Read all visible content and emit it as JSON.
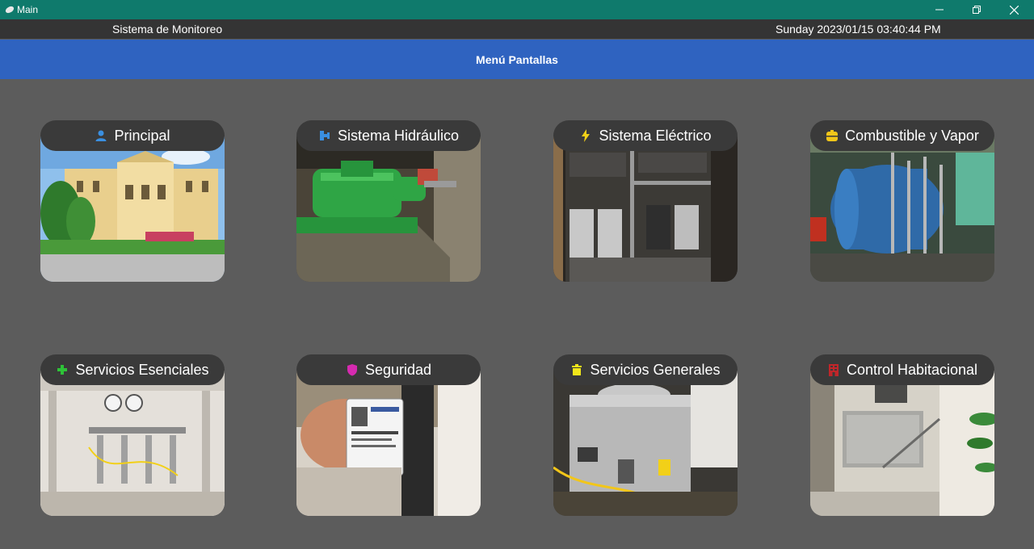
{
  "window": {
    "title": "Main"
  },
  "infobar": {
    "system_name": "Sistema de Monitoreo",
    "datetime": "Sunday 2023/01/15 03:40:44 PM"
  },
  "menu": {
    "title": "Menú Pantallas"
  },
  "cards": [
    {
      "label": "Principal",
      "icon": "person-icon",
      "icon_color": "#3a8fe0"
    },
    {
      "label": "Sistema Hidráulico",
      "icon": "pipe-icon",
      "icon_color": "#3a8fe0"
    },
    {
      "label": "Sistema Eléctrico",
      "icon": "lightning-icon",
      "icon_color": "#f2d018"
    },
    {
      "label": "Combustible y Vapor",
      "icon": "tank-icon",
      "icon_color": "#f2c619"
    },
    {
      "label": "Servicios Esenciales",
      "icon": "plus-icon",
      "icon_color": "#2ec238"
    },
    {
      "label": "Seguridad",
      "icon": "shield-icon",
      "icon_color": "#d62ab0"
    },
    {
      "label": "Servicios Generales",
      "icon": "trash-icon",
      "icon_color": "#f2e61a"
    },
    {
      "label": "Control Habitacional",
      "icon": "building-icon",
      "icon_color": "#c0262a"
    }
  ],
  "colors": {
    "titlebar": "#0f7a6c",
    "infobar": "#343434",
    "menubar": "#2f63c0",
    "background": "#5c5c5c",
    "card_label": "#3a3a3a"
  }
}
